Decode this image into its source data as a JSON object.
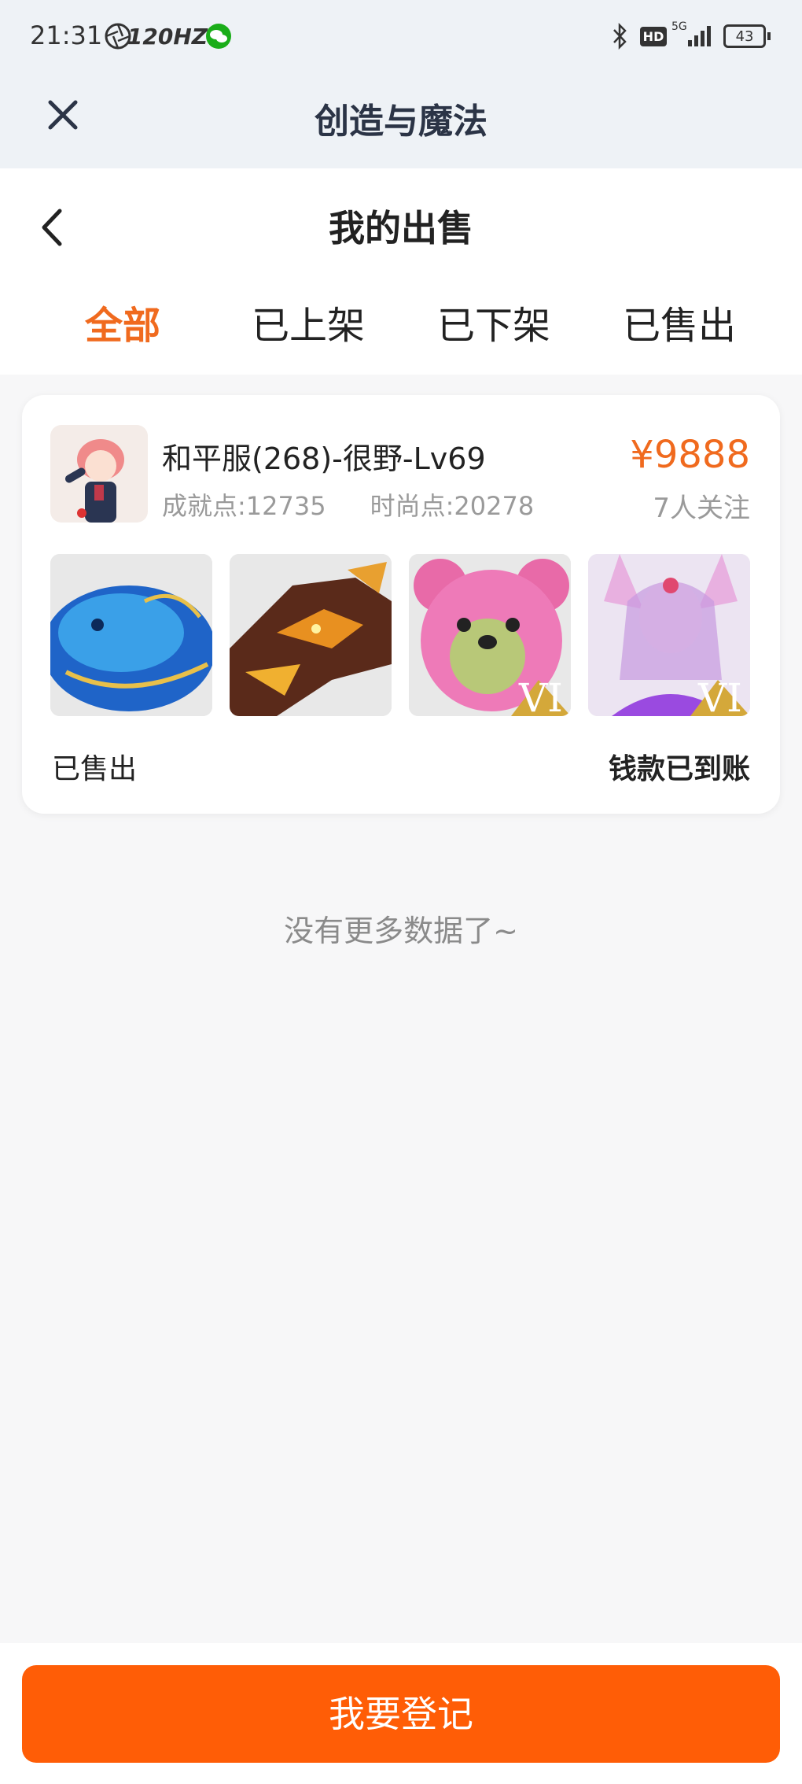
{
  "status_bar": {
    "time": "21:31",
    "refresh": "120HZ",
    "battery": "43",
    "network": "5G",
    "hd": "HD",
    "icons": [
      "aperture-icon",
      "wechat-icon",
      "bluetooth-icon",
      "hd-icon",
      "signal-icon",
      "battery-icon"
    ]
  },
  "app_bar": {
    "title": "创造与魔法",
    "close_icon": "close-icon"
  },
  "page": {
    "title": "我的出售",
    "back_icon": "back-chevron-icon"
  },
  "tabs": [
    {
      "label": "全部",
      "active": true
    },
    {
      "label": "已上架",
      "active": false
    },
    {
      "label": "已下架",
      "active": false
    },
    {
      "label": "已售出",
      "active": false
    }
  ],
  "listing": {
    "account_name": "和平服(268)-很野-Lv69",
    "achievement": "成就点:12735",
    "fashion": "时尚点:20278",
    "price": "¥9888",
    "followers": "7人关注",
    "thumbnails": [
      "blue-whale-mount",
      "fire-dragon-mount",
      "pink-bear-mount",
      "fox-spirit-character"
    ],
    "status": "已售出",
    "payment": "钱款已到账",
    "badge_text": "VI"
  },
  "empty_hint": "没有更多数据了~",
  "cta": {
    "label": "我要登记"
  },
  "colors": {
    "accent": "#f06a1e",
    "button": "#ff5d06",
    "bg": "#f7f7f8"
  }
}
